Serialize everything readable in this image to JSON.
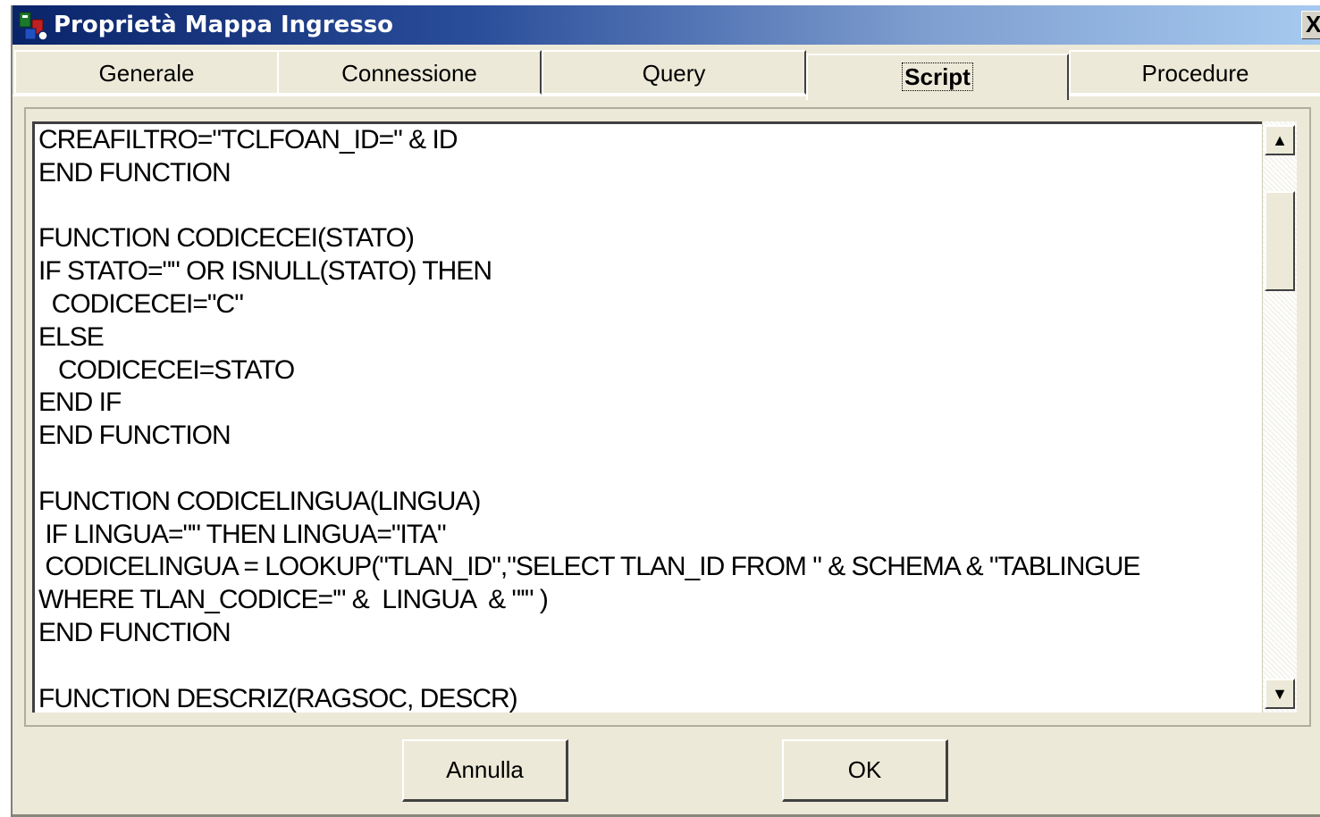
{
  "window": {
    "title": "Proprietà Mappa Ingresso",
    "close_glyph": "X"
  },
  "tabs": [
    {
      "label": "Generale",
      "active": false
    },
    {
      "label": "Connessione",
      "active": false
    },
    {
      "label": "Query",
      "active": false
    },
    {
      "label": "Script",
      "active": true
    },
    {
      "label": "Procedure",
      "active": false
    }
  ],
  "editor": {
    "lines": [
      "CREAFILTRO=\"TCLFOAN_ID=\" & ID",
      "END FUNCTION",
      "",
      "FUNCTION CODICECEI(STATO)",
      "IF STATO=\"\" OR ISNULL(STATO) THEN",
      "  CODICECEI=\"C\"",
      "ELSE",
      "   CODICECEI=STATO",
      "END IF",
      "END FUNCTION",
      "",
      "FUNCTION CODICELINGUA(LINGUA)",
      " IF LINGUA=\"\" THEN LINGUA=\"ITA\"",
      " CODICELINGUA = LOOKUP(\"TLAN_ID\",\"SELECT TLAN_ID FROM \" & SCHEMA & \"TABLINGUE",
      "WHERE TLAN_CODICE='\" &  LINGUA  & \"'\" )",
      "END FUNCTION",
      "",
      "FUNCTION DESCRIZ(RAGSOC, DESCR)"
    ]
  },
  "scrollbar": {
    "up_glyph": "▲",
    "down_glyph": "▼"
  },
  "buttons": {
    "cancel_label": "Annulla",
    "ok_label": "OK"
  },
  "colors": {
    "titlebar_start": "#0a246a",
    "titlebar_end": "#a6caf0",
    "dialog_bg": "#ece9d8"
  },
  "icons": {
    "app": "app-icon",
    "close": "close-icon"
  }
}
